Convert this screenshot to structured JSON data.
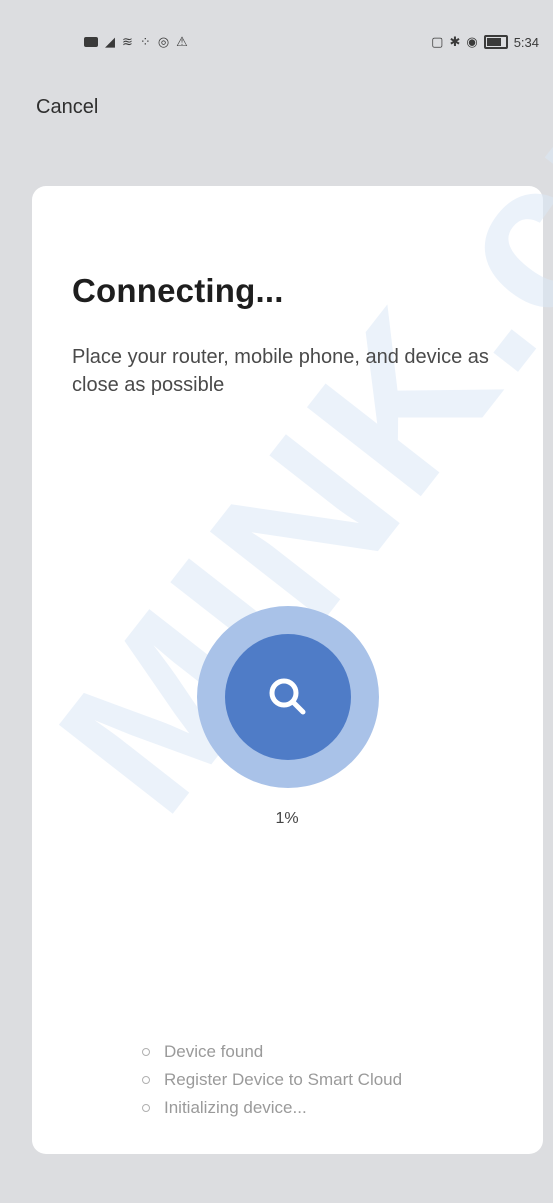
{
  "status_bar": {
    "time": "5:34"
  },
  "header": {
    "cancel_label": "Cancel"
  },
  "card": {
    "title": "Connecting...",
    "subtitle": "Place your router, mobile phone, and device as close as possible",
    "progress": {
      "percent_label": "1%",
      "value_percent": 1
    },
    "steps": [
      {
        "label": "Device found"
      },
      {
        "label": "Register Device to Smart Cloud"
      },
      {
        "label": "Initializing device..."
      }
    ]
  },
  "watermark": {
    "text": "MINK.cz"
  },
  "colors": {
    "accent": "#4f7cc7",
    "accent_light": "#a9c2e8",
    "background": "#dcdde0",
    "card": "#ffffff"
  }
}
